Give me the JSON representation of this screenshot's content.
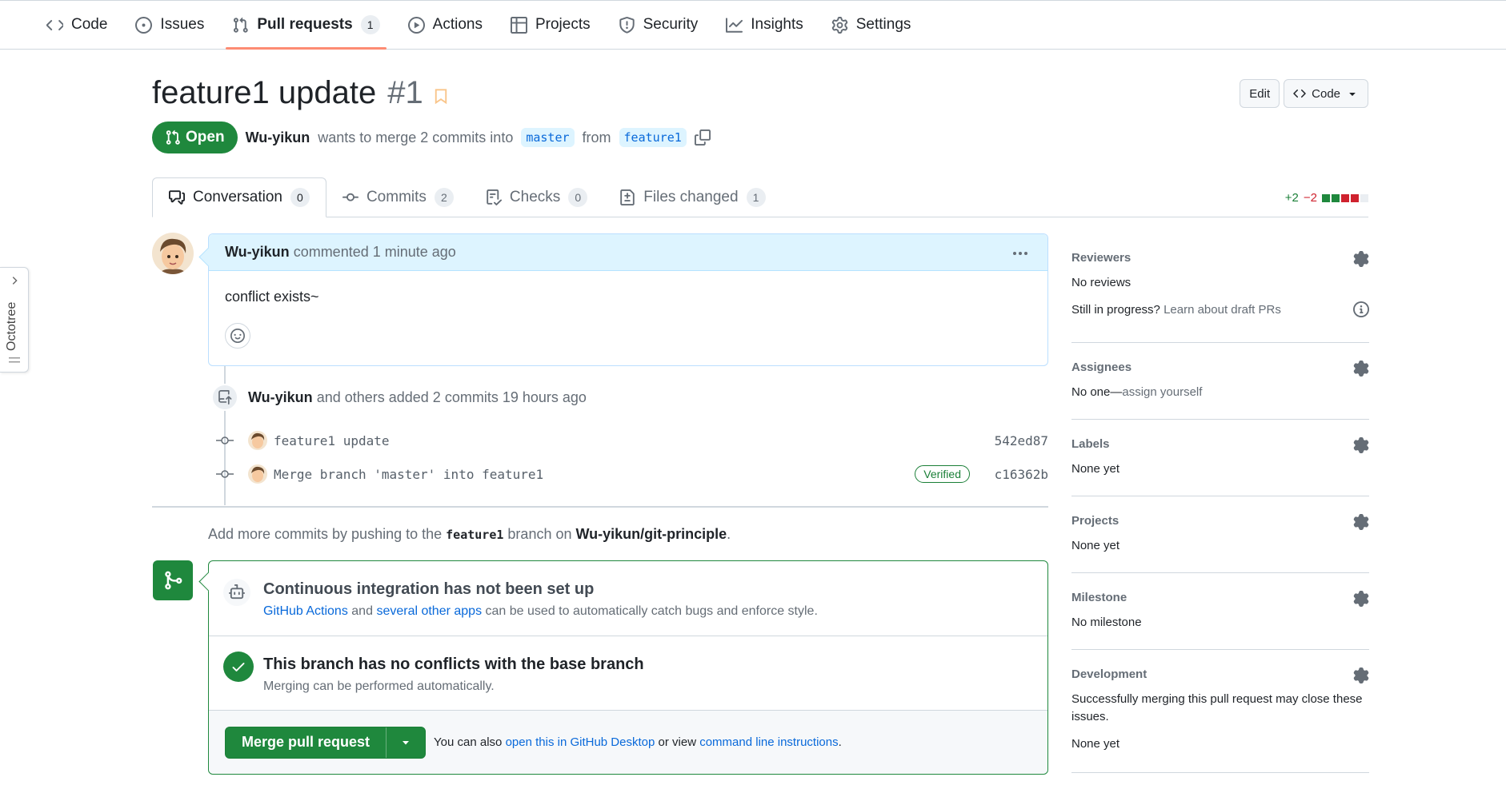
{
  "nav": {
    "items": [
      {
        "label": "Code",
        "icon": "code-icon"
      },
      {
        "label": "Issues",
        "icon": "issue-icon"
      },
      {
        "label": "Pull requests",
        "icon": "pull-request-icon",
        "count": "1",
        "active": true
      },
      {
        "label": "Actions",
        "icon": "play-icon"
      },
      {
        "label": "Projects",
        "icon": "table-icon"
      },
      {
        "label": "Security",
        "icon": "shield-icon"
      },
      {
        "label": "Insights",
        "icon": "graph-icon"
      },
      {
        "label": "Settings",
        "icon": "gear-icon"
      }
    ]
  },
  "pr": {
    "title": "feature1 update",
    "number": "#1",
    "state": "Open",
    "author": "Wu-yikun",
    "merge_text": "wants to merge 2 commits into",
    "base_branch": "master",
    "from_text": "from",
    "head_branch": "feature1",
    "edit_label": "Edit",
    "code_label": "Code"
  },
  "tabs": [
    {
      "label": "Conversation",
      "count": "0",
      "icon": "comment-discussion-icon"
    },
    {
      "label": "Commits",
      "count": "2",
      "icon": "commit-icon"
    },
    {
      "label": "Checks",
      "count": "0",
      "icon": "checklist-icon"
    },
    {
      "label": "Files changed",
      "count": "1",
      "icon": "file-diff-icon"
    }
  ],
  "diffstat": {
    "additions": "+2",
    "deletions": "−2"
  },
  "octotree": {
    "label": "Octotree"
  },
  "comment": {
    "author": "Wu-yikun",
    "meta": "commented 1 minute ago",
    "body": "conflict exists~"
  },
  "commits_event": {
    "author": "Wu-yikun",
    "text": "and others added 2 commits 19 hours ago",
    "commits": [
      {
        "message": "feature1 update",
        "sha": "542ed87",
        "verified": ""
      },
      {
        "message": "Merge branch 'master' into feature1",
        "sha": "c16362b",
        "verified": "Verified"
      }
    ]
  },
  "add_commits": {
    "prefix": "Add more commits by pushing to the",
    "branch": "feature1",
    "middle": "branch on",
    "repo": "Wu-yikun/git-principle",
    "suffix": "."
  },
  "merge": {
    "ci_title": "Continuous integration has not been set up",
    "ci_link1": "GitHub Actions",
    "ci_and": "and",
    "ci_link2": "several other apps",
    "ci_rest": "can be used to automatically catch bugs and enforce style.",
    "conflict_title": "This branch has no conflicts with the base branch",
    "conflict_sub": "Merging can be performed automatically.",
    "button_label": "Merge pull request",
    "also_text": "You can also",
    "desktop_link": "open this in GitHub Desktop",
    "or_view": "or view",
    "cli_link": "command line instructions",
    "period": "."
  },
  "sidebar": {
    "reviewers": {
      "title": "Reviewers",
      "value": "No reviews",
      "draft_q": "Still in progress?",
      "draft_link": "Learn about draft PRs"
    },
    "assignees": {
      "title": "Assignees",
      "value": "No one—",
      "assign_link": "assign yourself"
    },
    "labels": {
      "title": "Labels",
      "value": "None yet"
    },
    "projects": {
      "title": "Projects",
      "value": "None yet"
    },
    "milestone": {
      "title": "Milestone",
      "value": "No milestone"
    },
    "development": {
      "title": "Development",
      "desc": "Successfully merging this pull request may close these issues.",
      "value": "None yet"
    }
  },
  "colors": {
    "accent_green": "#1f883d",
    "link_blue": "#0969da",
    "nav_active_underline": "#fd8c73"
  }
}
